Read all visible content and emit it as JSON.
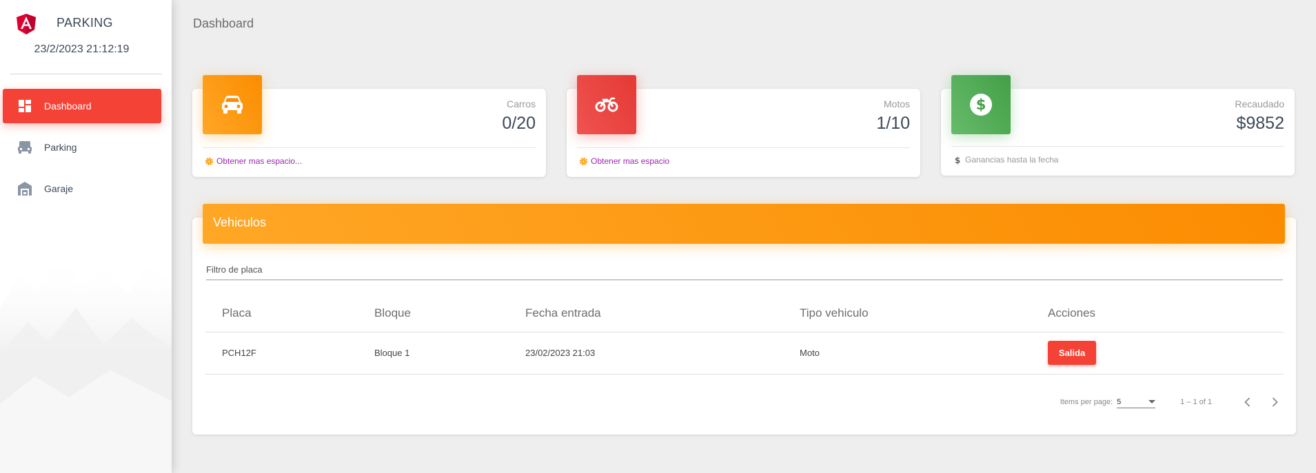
{
  "sidebar": {
    "app_title": "PARKING",
    "clock": "23/2/2023 21:12:19",
    "items": [
      {
        "label": "Dashboard",
        "icon": "dashboard-icon",
        "active": true
      },
      {
        "label": "Parking",
        "icon": "car-seat-icon",
        "active": false
      },
      {
        "label": "Garaje",
        "icon": "garage-icon",
        "active": false
      }
    ],
    "accent": "#f44336"
  },
  "header": {
    "page_title": "Dashboard"
  },
  "stats": [
    {
      "category": "Carros",
      "value": "0/20",
      "footer": "Obtener mas espacio...",
      "icon": "car-icon",
      "footer_icon": "gear-icon",
      "color": "#fb8c00"
    },
    {
      "category": "Motos",
      "value": "1/10",
      "footer": "Obtener mas espacio",
      "icon": "motorcycle-icon",
      "footer_icon": "gear-icon",
      "color": "#e53935"
    },
    {
      "category": "Recaudado",
      "value": "$9852",
      "footer": "Ganancias hasta la fecha",
      "icon": "dollar-circle-icon",
      "footer_icon": "dollar-icon",
      "color": "#43a047"
    }
  ],
  "vehicles": {
    "title": "Vehiculos",
    "filter_placeholder": "Filtro de placa",
    "columns": [
      "Placa",
      "Bloque",
      "Fecha entrada",
      "Tipo vehiculo",
      "Acciones"
    ],
    "rows": [
      {
        "placa": "PCH12F",
        "bloque": "Bloque 1",
        "fecha": "23/02/2023 21:03",
        "tipo": "Moto",
        "action": "Salida"
      }
    ],
    "paginator": {
      "items_per_page_label": "Items per page:",
      "page_size": "5",
      "range": "1 – 1 of 1"
    }
  }
}
